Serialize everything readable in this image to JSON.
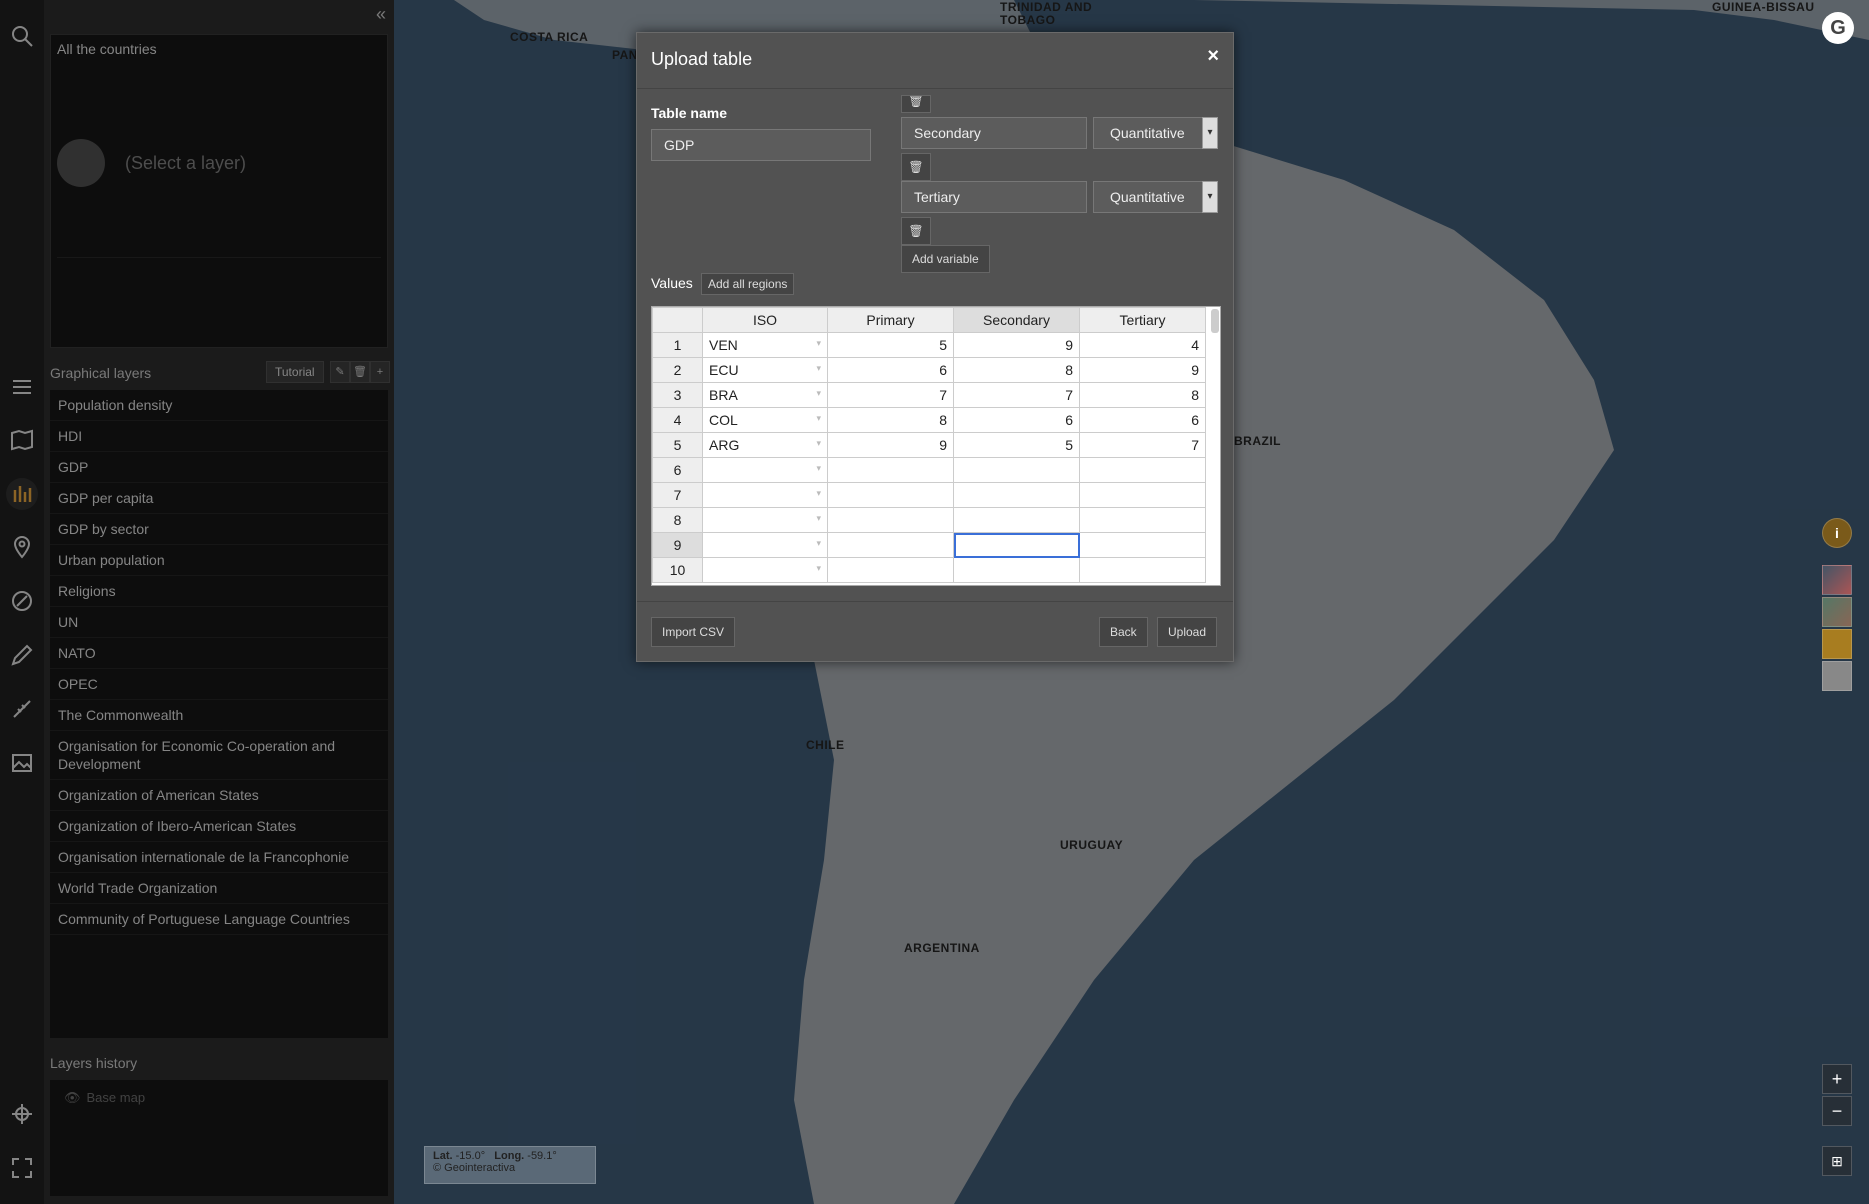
{
  "sidebar": {
    "collapse": "«",
    "selection": {
      "title": "All the countries",
      "hint": "(Select a layer)"
    },
    "graphical_layers": {
      "label": "Graphical layers",
      "tutorial": "Tutorial",
      "items": [
        "Population density",
        "HDI",
        "GDP",
        "GDP per capita",
        "GDP by sector",
        "Urban population",
        "Religions",
        "UN",
        "NATO",
        "OPEC",
        "The Commonwealth",
        "Organisation for Economic Co-operation and Development",
        "Organization of American States",
        "Organization of Ibero-American States",
        "Organisation internationale de la Francophonie",
        "World Trade Organization",
        "Community of Portuguese Language Countries"
      ]
    },
    "history": {
      "label": "Layers history",
      "items": [
        "Base map"
      ]
    }
  },
  "toolbar_icons": [
    "search-icon",
    "list-icon",
    "map-icon",
    "chart-icon",
    "pin-icon",
    "edit-icon",
    "pencil-icon",
    "ruler-icon",
    "image-icon",
    "crosshair-icon",
    "fullscreen-icon"
  ],
  "map": {
    "labels": [
      "COSTA RICA",
      "PANAMA",
      "TRINIDAD AND",
      "TOBAGO",
      "GUINEA-BISSAU",
      "BRAZIL",
      "CHILE",
      "URUGUAY",
      "ARGENTINA"
    ],
    "coords": {
      "lat_label": "Lat.",
      "lat": "-15.0°",
      "long_label": "Long.",
      "long": "-59.1°",
      "copyright": "© Geointeractiva"
    },
    "zoom_in": "+",
    "zoom_out": "−",
    "info": "i"
  },
  "dialog": {
    "title": "Upload table",
    "close": "×",
    "table_name_label": "Table name",
    "table_name": "GDP",
    "variables": [
      {
        "name": "Secondary",
        "type": "Quantitative"
      },
      {
        "name": "Tertiary",
        "type": "Quantitative"
      }
    ],
    "delete_icon": "🗑",
    "caret": "▾",
    "add_variable": "Add variable",
    "values_label": "Values",
    "add_all_regions": "Add all regions",
    "grid": {
      "headers": [
        "",
        "ISO",
        "Primary",
        "Secondary",
        "Tertiary"
      ],
      "rows": [
        [
          "1",
          "VEN",
          "5",
          "9",
          "4"
        ],
        [
          "2",
          "ECU",
          "6",
          "8",
          "9"
        ],
        [
          "3",
          "BRA",
          "7",
          "7",
          "8"
        ],
        [
          "4",
          "COL",
          "8",
          "6",
          "6"
        ],
        [
          "5",
          "ARG",
          "9",
          "5",
          "7"
        ],
        [
          "6",
          "",
          "",
          "",
          ""
        ],
        [
          "7",
          "",
          "",
          "",
          ""
        ],
        [
          "8",
          "",
          "",
          "",
          ""
        ],
        [
          "9",
          "",
          "",
          "",
          ""
        ],
        [
          "10",
          "",
          "",
          "",
          ""
        ]
      ]
    },
    "import_csv": "Import CSV",
    "back": "Back",
    "upload": "Upload"
  }
}
